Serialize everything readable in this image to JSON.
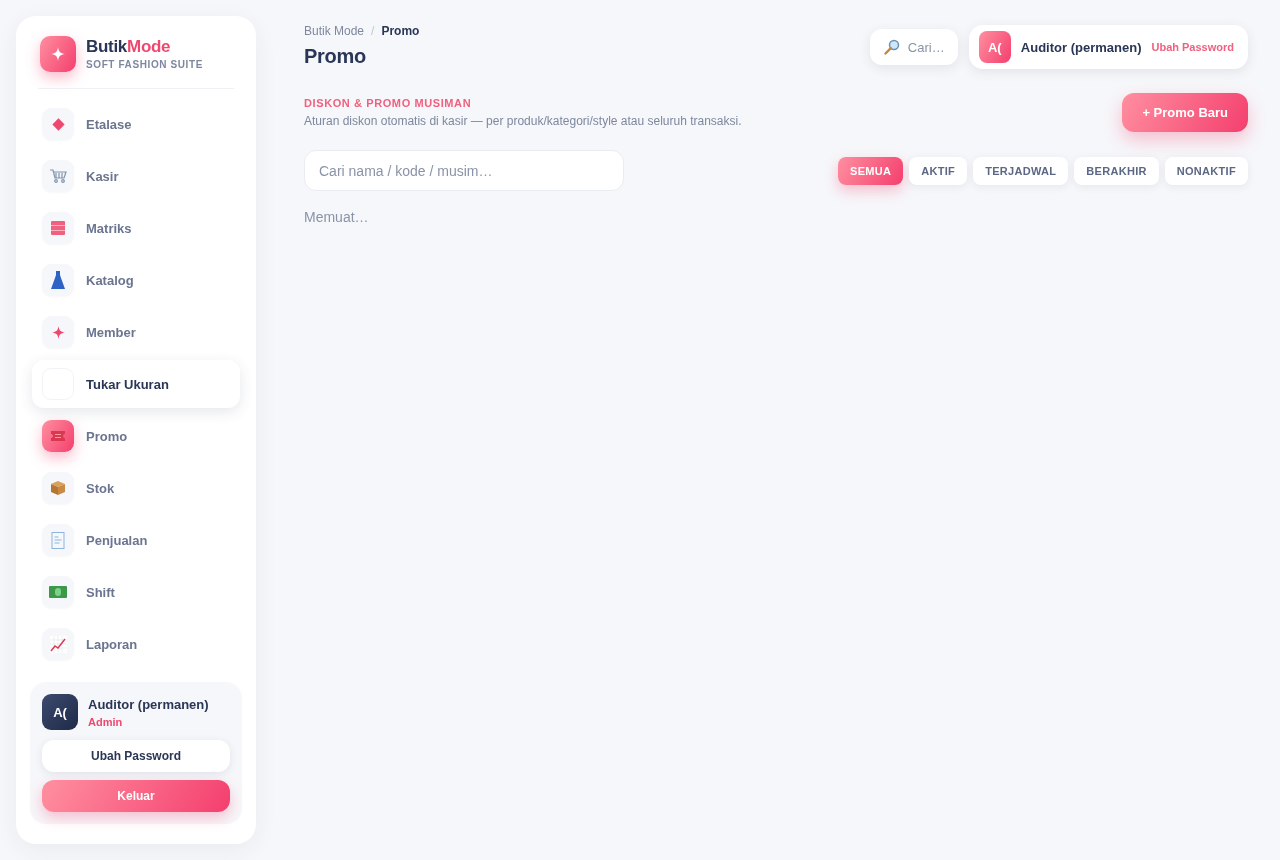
{
  "sidebar": {
    "brand": {
      "name": "Butik",
      "name_accent": "Mode",
      "tagline": "SOFT FASHION SUITE"
    },
    "nav_items": [
      {
        "label": "Etalase",
        "selected": false,
        "hovered": false
      },
      {
        "label": "Kasir",
        "selected": false,
        "hovered": false
      },
      {
        "label": "Matriks",
        "selected": false,
        "hovered": false
      },
      {
        "label": "Katalog",
        "selected": false,
        "hovered": false
      },
      {
        "label": "Member",
        "selected": false,
        "hovered": false
      },
      {
        "label": "Tukar Ukuran",
        "selected": false,
        "hovered": true
      },
      {
        "label": "Promo",
        "selected": true,
        "hovered": false
      },
      {
        "label": "Stok",
        "selected": false,
        "hovered": false
      },
      {
        "label": "Penjualan",
        "selected": false,
        "hovered": false
      },
      {
        "label": "Shift",
        "selected": false,
        "hovered": false
      },
      {
        "label": "Laporan",
        "selected": false,
        "hovered": false
      }
    ],
    "user_card": {
      "avatar": "A(",
      "name": "Auditor (permanen)",
      "role": "Admin",
      "buttons": [
        {
          "label": "Ubah Password",
          "kind": "secondary"
        },
        {
          "label": "Keluar",
          "kind": "primary"
        }
      ]
    }
  },
  "header": {
    "breadcrumb": {
      "items": [
        "Butik Mode",
        "Promo"
      ],
      "separator": "/"
    },
    "title": "Promo",
    "search": {
      "placeholder": "Cari…"
    },
    "user_chip": {
      "avatar": "A(",
      "name": "Auditor (permanen)",
      "link": "Ubah Password"
    }
  },
  "section": {
    "eyebrow": "DISKON & PROMO MUSIMAN",
    "description": "Aturan diskon otomatis di kasir — per produk/kategori/style atau seluruh transaksi.",
    "new_button": "+ Promo Baru"
  },
  "search": {
    "placeholder": "Cari nama / kode / musim…"
  },
  "filters": [
    {
      "label": "SEMUA",
      "selected": true
    },
    {
      "label": "AKTIF",
      "selected": false
    },
    {
      "label": "TERJADWAL",
      "selected": false
    },
    {
      "label": "BERAKHIR",
      "selected": false
    },
    {
      "label": "NONAKTIF",
      "selected": false
    }
  ],
  "status": "Memuat…"
}
